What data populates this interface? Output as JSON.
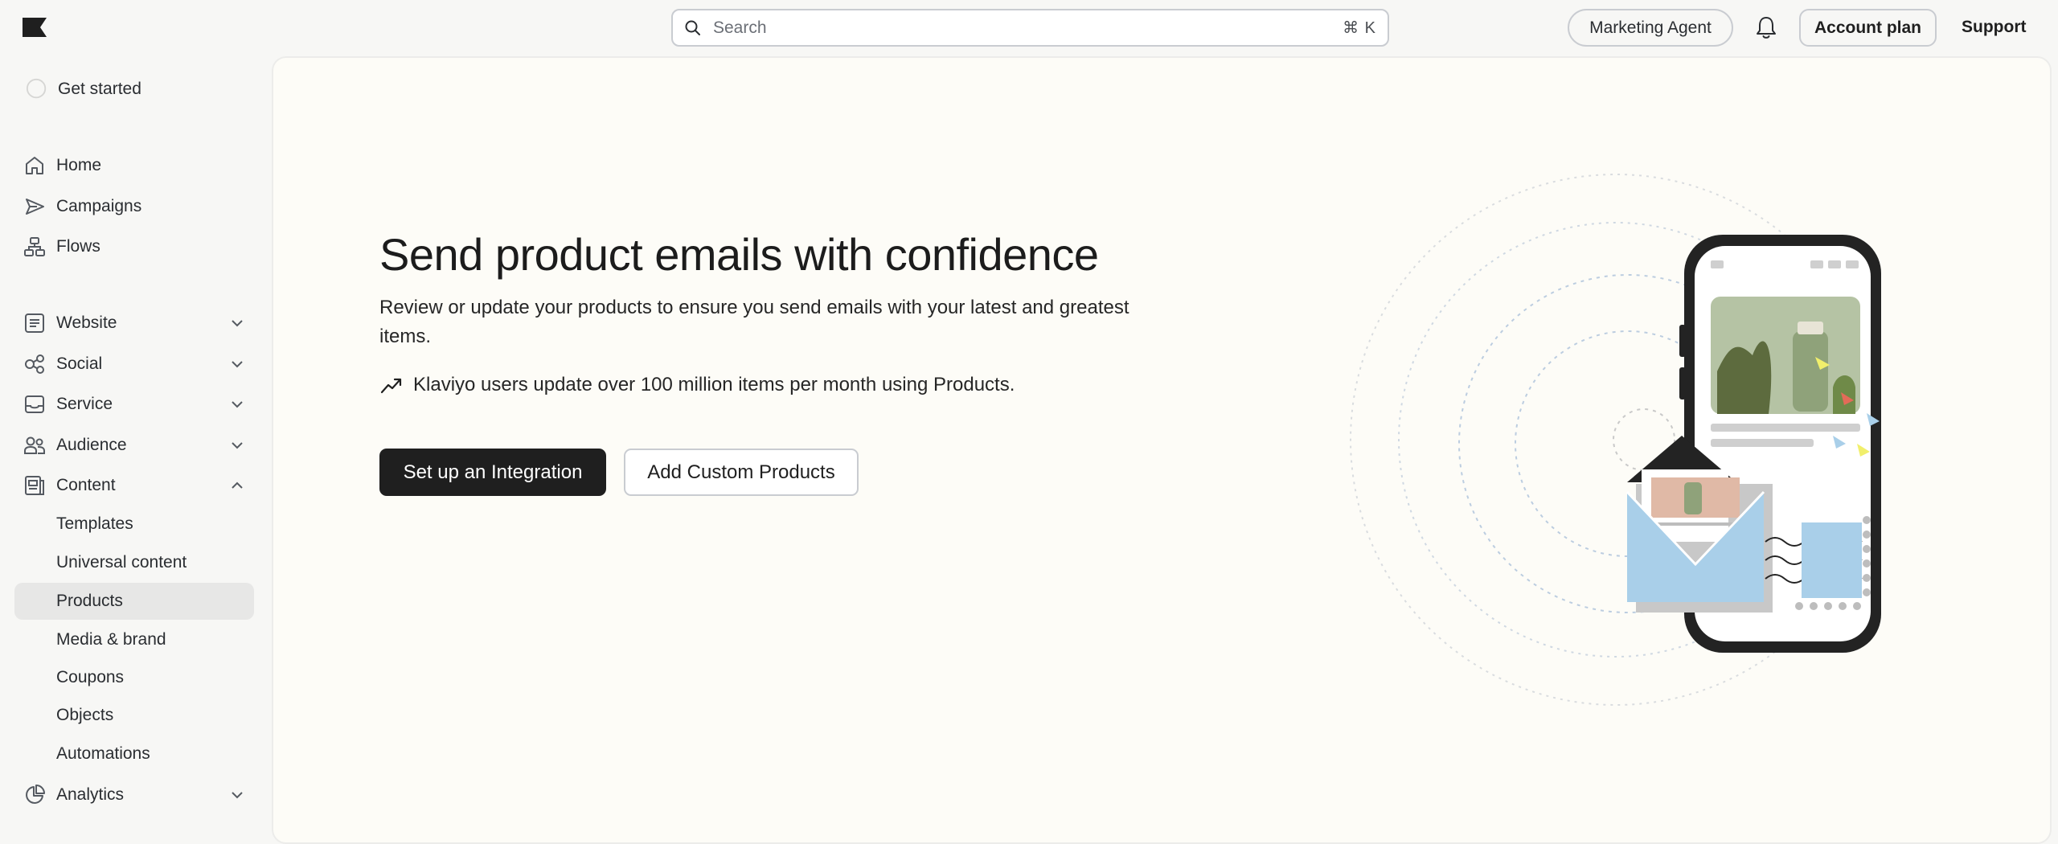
{
  "topbar": {
    "search": {
      "placeholder": "Search",
      "shortcut": "⌘ K"
    },
    "agent_label": "Marketing Agent",
    "account_label": "Account plan",
    "support_label": "Support"
  },
  "sidebar": {
    "get_started": "Get started",
    "items": [
      {
        "label": "Home",
        "icon": "home-icon"
      },
      {
        "label": "Campaigns",
        "icon": "send-icon"
      },
      {
        "label": "Flows",
        "icon": "flows-icon"
      },
      {
        "label": "Website",
        "icon": "website-icon",
        "expandable": true
      },
      {
        "label": "Social",
        "icon": "social-icon",
        "expandable": true
      },
      {
        "label": "Service",
        "icon": "inbox-icon",
        "expandable": true
      },
      {
        "label": "Audience",
        "icon": "audience-icon",
        "expandable": true
      },
      {
        "label": "Content",
        "icon": "content-icon",
        "expanded": true
      },
      {
        "label": "Analytics",
        "icon": "analytics-icon",
        "expandable": true
      }
    ],
    "content_sub": [
      "Templates",
      "Universal content",
      "Products",
      "Media & brand",
      "Coupons",
      "Objects",
      "Automations"
    ],
    "active_sub": "Products"
  },
  "main": {
    "title": "Send product emails with confidence",
    "description": "Review or update your products to ensure you send emails with your latest and greatest items.",
    "stat": "Klaviyo users update over 100 million items per month using Products.",
    "primary_button": "Set up an Integration",
    "secondary_button": "Add Custom Products"
  },
  "colors": {
    "page_bg": "#f7f7f5",
    "main_bg": "#fdfcf7",
    "primary": "#1f1f1f",
    "active_item_bg": "#e7e7e6",
    "illustration_blue": "#a9cfe9",
    "illustration_green": "#8fa27a"
  }
}
